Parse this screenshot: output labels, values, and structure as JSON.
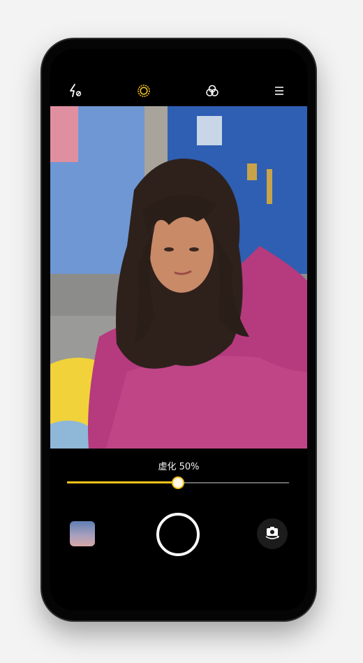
{
  "topbar": {
    "icons": [
      "flash-off-icon",
      "beauty-ring-icon",
      "filters-icon",
      "menu-icon"
    ]
  },
  "camera": {
    "blur_label": "虚化 50%",
    "blur_level": 0.5
  },
  "bottom": {
    "gallery_icon": "gallery-thumbnail",
    "shutter_icon": "shutter-button",
    "switch_icon": "switch-camera-icon"
  },
  "colors": {
    "accent": "#f4c21a",
    "background": "#000000"
  }
}
